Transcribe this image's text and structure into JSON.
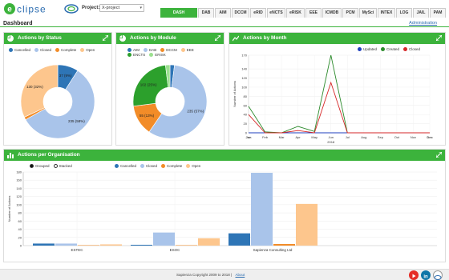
{
  "header": {
    "project_label": "Project:",
    "project_value": "X-project",
    "tabs": [
      {
        "label": "DASH",
        "active": true,
        "w": 46
      },
      {
        "label": "DAB",
        "w": 20
      },
      {
        "label": "AIM",
        "w": 20
      },
      {
        "label": "DCCM",
        "w": 22
      },
      {
        "label": "eRID",
        "w": 20
      },
      {
        "label": "eNCTS",
        "w": 23
      },
      {
        "label": "eRISK",
        "w": 23
      },
      {
        "label": "EEE",
        "w": 20
      },
      {
        "label": "ICMDB",
        "w": 24
      },
      {
        "label": "PCM",
        "w": 20
      },
      {
        "label": "MySci",
        "w": 22
      },
      {
        "label": "INTEX",
        "w": 22
      },
      {
        "label": "LOG",
        "w": 20
      },
      {
        "label": "JAIL",
        "w": 20
      },
      {
        "label": "PAM",
        "w": 20
      }
    ]
  },
  "page": {
    "title": "Dashboard",
    "admin_link": "Administration"
  },
  "panels": {
    "status": {
      "title": "Actions by Status",
      "legend": [
        {
          "label": "Cancelled",
          "color": "#2e75b6"
        },
        {
          "label": "Closed",
          "color": "#a9c4ea"
        },
        {
          "label": "Complete",
          "color": "#f28c28"
        },
        {
          "label": "Open",
          "color": "#fdc68d"
        }
      ]
    },
    "module": {
      "title": "Actions by Module",
      "legend": [
        {
          "label": "AIM",
          "color": "#2e75b6"
        },
        {
          "label": "DAB",
          "color": "#a9c4ea"
        },
        {
          "label": "DCCM",
          "color": "#f28c28"
        },
        {
          "label": "EEE",
          "color": "#fdc68d"
        },
        {
          "label": "ENCTS",
          "color": "#2ca02c"
        },
        {
          "label": "ERISK",
          "color": "#9be08f"
        }
      ]
    },
    "month": {
      "title": "Actions by Month",
      "legend": [
        {
          "label": "Updated",
          "color": "#1f3fbf"
        },
        {
          "label": "Created",
          "color": "#2b8a2b"
        },
        {
          "label": "Closed",
          "color": "#d62728"
        }
      ]
    },
    "org": {
      "title": "Actions per Organisation",
      "toggle": [
        {
          "label": "Grouped",
          "color": "#111111"
        },
        {
          "label": "Stacked",
          "color": "#ffffff"
        }
      ],
      "legend": [
        {
          "label": "Cancelled",
          "color": "#2e75b6"
        },
        {
          "label": "Closed",
          "color": "#a9c4ea"
        },
        {
          "label": "Complete",
          "color": "#f28c28"
        },
        {
          "label": "Open",
          "color": "#fdc68d"
        }
      ]
    }
  },
  "chart_data": [
    {
      "type": "pie",
      "title": "Actions by Status",
      "donut": true,
      "slices": [
        {
          "label": "Cancelled",
          "value": 37,
          "text": "37 (9%)",
          "color": "#2e75b6"
        },
        {
          "label": "Closed",
          "value": 235,
          "text": "235 (58%)",
          "color": "#a9c4ea"
        },
        {
          "label": "Complete",
          "value": 5,
          "text": "",
          "color": "#f28c28"
        },
        {
          "label": "Open",
          "value": 130,
          "text": "130 (32%)",
          "color": "#fdc68d"
        }
      ]
    },
    {
      "type": "pie",
      "title": "Actions by Module",
      "donut": true,
      "slices": [
        {
          "label": "AIM",
          "value": 8,
          "text": "",
          "color": "#2e75b6"
        },
        {
          "label": "DAB",
          "value": 235,
          "text": "235 (57%)",
          "color": "#a9c4ea"
        },
        {
          "label": "DCCM",
          "value": 55,
          "text": "55 (13%)",
          "color": "#f28c28"
        },
        {
          "label": "EEE",
          "value": 0,
          "text": "",
          "color": "#fdc68d"
        },
        {
          "label": "ENCTS",
          "value": 102,
          "text": "102 (25%)",
          "color": "#2ca02c"
        },
        {
          "label": "ERISK",
          "value": 8,
          "text": "",
          "color": "#9be08f"
        }
      ]
    },
    {
      "type": "line",
      "title": "Actions by Month",
      "categories": [
        "Jan",
        "Feb",
        "Mar",
        "Apr",
        "May",
        "Jun",
        "Jul",
        "Aug",
        "Sep",
        "Oct",
        "Nov",
        "Dec"
      ],
      "ylabel": "Number of Actions",
      "xlabel": "2018",
      "ylim": [
        0,
        170
      ],
      "yticks": [
        0,
        20,
        40,
        60,
        80,
        100,
        120,
        140,
        170
      ],
      "series": [
        {
          "name": "Updated",
          "color": "#1f3fbf",
          "values": [
            0,
            0,
            0,
            0,
            0,
            0,
            0,
            0,
            0,
            0,
            0,
            0
          ]
        },
        {
          "name": "Created",
          "color": "#2b8a2b",
          "values": [
            58,
            2,
            0,
            14,
            3,
            170,
            0,
            0,
            0,
            0,
            0,
            0
          ]
        },
        {
          "name": "Closed",
          "color": "#d62728",
          "values": [
            40,
            0,
            0,
            5,
            0,
            110,
            0,
            0,
            0,
            0,
            0,
            0
          ]
        }
      ]
    },
    {
      "type": "bar",
      "title": "Actions per Organisation",
      "categories": [
        "ESTEC",
        "ESOC",
        "Sapienza Consulting Ltd"
      ],
      "ylabel": "Number of Actions",
      "ylim": [
        0,
        180
      ],
      "yticks": [
        0,
        20,
        40,
        60,
        80,
        100,
        120,
        140,
        160,
        180
      ],
      "series": [
        {
          "name": "Cancelled",
          "color": "#2e75b6",
          "values": [
            5,
            2,
            30
          ]
        },
        {
          "name": "Closed",
          "color": "#a9c4ea",
          "values": [
            5,
            32,
            178
          ]
        },
        {
          "name": "Complete",
          "color": "#f28c28",
          "values": [
            1,
            1,
            4
          ]
        },
        {
          "name": "Open",
          "color": "#fdc68d",
          "values": [
            3,
            18,
            102
          ]
        }
      ]
    }
  ],
  "footer": {
    "copyright": "Sapienza Copyright 2009 to 2018",
    "separator": "|",
    "about": "About"
  },
  "colors": {
    "accent": "#3cb33c",
    "youtube": "#e52d27",
    "linkedin": "#0e76a8"
  }
}
